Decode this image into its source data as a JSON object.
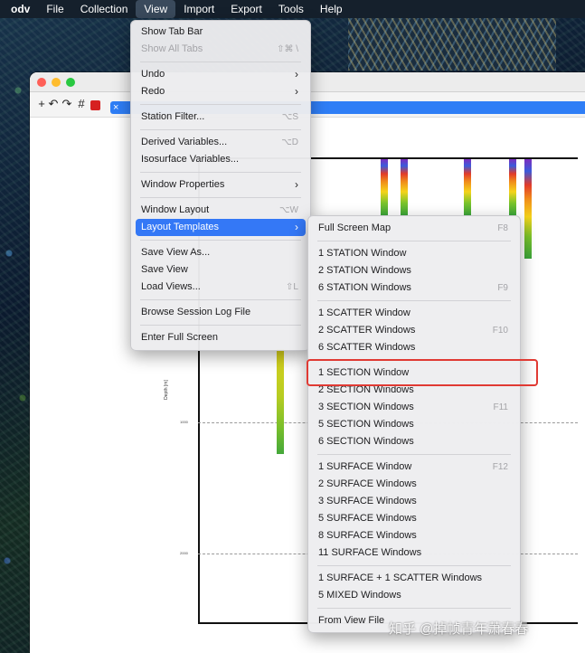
{
  "menubar": {
    "app": "odv",
    "items": [
      "File",
      "Collection",
      "View",
      "Import",
      "Export",
      "Tools",
      "Help"
    ]
  },
  "plot": {
    "y_axis_title": "Depth [m]",
    "y_ticks": [
      "1000",
      "2000"
    ]
  },
  "view_menu": {
    "items": [
      {
        "label": "Show Tab Bar",
        "shortcut": ""
      },
      {
        "label": "Show All Tabs",
        "shortcut": "⇧⌘ \\"
      },
      {
        "label": "Undo",
        "shortcut": ""
      },
      {
        "label": "Redo",
        "shortcut": ""
      },
      {
        "label": "Station Filter...",
        "shortcut": "⌥S"
      },
      {
        "label": "Derived Variables...",
        "shortcut": "⌥D"
      },
      {
        "label": "Isosurface Variables...",
        "shortcut": ""
      },
      {
        "label": "Window Properties",
        "shortcut": ""
      },
      {
        "label": "Window Layout",
        "shortcut": "⌥W"
      },
      {
        "label": "Layout Templates",
        "shortcut": ""
      },
      {
        "label": "Save View As...",
        "shortcut": ""
      },
      {
        "label": "Save View",
        "shortcut": ""
      },
      {
        "label": "Load Views...",
        "shortcut": "⇧L"
      },
      {
        "label": "Browse Session Log File",
        "shortcut": ""
      },
      {
        "label": "Enter Full Screen",
        "shortcut": ""
      }
    ]
  },
  "layout_templates_submenu": {
    "items": [
      {
        "label": "Full Screen Map",
        "shortcut": "F8"
      },
      {
        "label": "1 STATION Window",
        "shortcut": ""
      },
      {
        "label": "2 STATION Windows",
        "shortcut": ""
      },
      {
        "label": "6 STATION Windows",
        "shortcut": "F9"
      },
      {
        "label": "1 SCATTER Window",
        "shortcut": ""
      },
      {
        "label": "2 SCATTER Windows",
        "shortcut": "F10"
      },
      {
        "label": "6 SCATTER Windows",
        "shortcut": ""
      },
      {
        "label": "1 SECTION Window",
        "shortcut": ""
      },
      {
        "label": "2 SECTION Windows",
        "shortcut": ""
      },
      {
        "label": "3 SECTION Windows",
        "shortcut": "F11"
      },
      {
        "label": "5 SECTION Windows",
        "shortcut": ""
      },
      {
        "label": "6 SECTION Windows",
        "shortcut": ""
      },
      {
        "label": "1 SURFACE Window",
        "shortcut": "F12"
      },
      {
        "label": "2 SURFACE Windows",
        "shortcut": ""
      },
      {
        "label": "3 SURFACE Windows",
        "shortcut": ""
      },
      {
        "label": "5 SURFACE Windows",
        "shortcut": ""
      },
      {
        "label": "8 SURFACE Windows",
        "shortcut": ""
      },
      {
        "label": "11 SURFACE Windows",
        "shortcut": ""
      },
      {
        "label": "1 SURFACE + 1 SCATTER Windows",
        "shortcut": ""
      },
      {
        "label": "5 MIXED Windows",
        "shortcut": ""
      },
      {
        "label": "From View File",
        "shortcut": ""
      }
    ]
  },
  "watermark": "知乎 @掉帧青年萧春春"
}
